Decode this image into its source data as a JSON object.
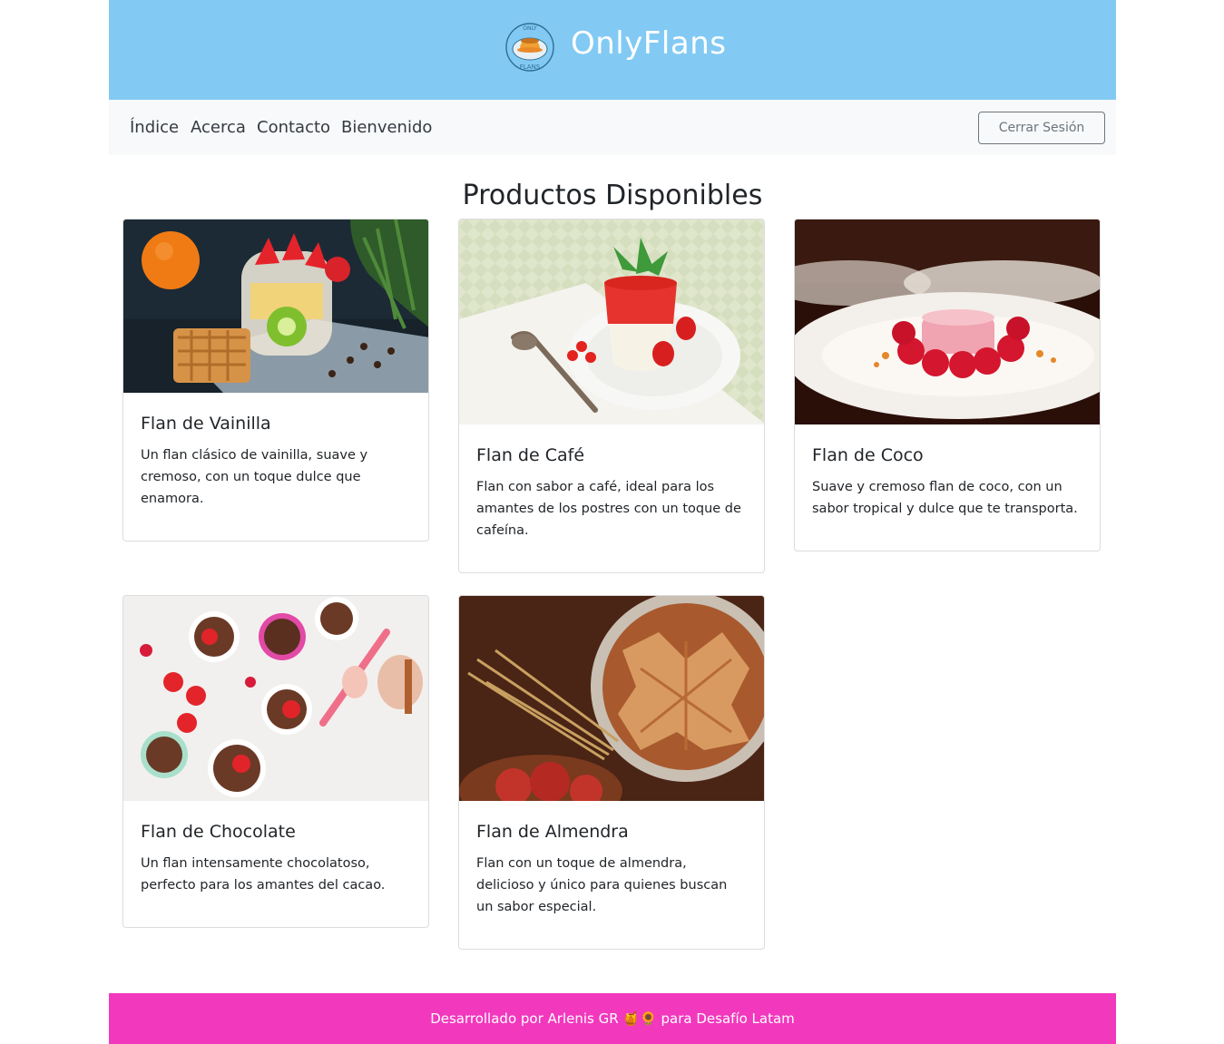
{
  "header": {
    "logo_text_top": "ONLY",
    "logo_text_bottom": "FLANS",
    "title": "OnlyFlans",
    "colors": {
      "bar": "#82caf4"
    }
  },
  "nav": {
    "links": [
      "Índice",
      "Acerca",
      "Contacto",
      "Bienvenido"
    ],
    "logout_label": "Cerrar Sesión"
  },
  "main": {
    "title": "Productos Disponibles",
    "products": [
      {
        "name": "Flan de Vainilla",
        "description": "Un flan clásico de vainilla, suave y cremoso, con un toque dulce que enamora.",
        "image": "fruit-parfait-with-waffle-photo"
      },
      {
        "name": "Flan de Café",
        "description": "Flan con sabor a café, ideal para los amantes de los postres con un toque de cafeína.",
        "image": "strawberry-panna-cotta-photo"
      },
      {
        "name": "Flan de Coco",
        "description": "Suave y cremoso flan de coco, con un sabor tropical y dulce que te transporta.",
        "image": "raspberry-dessert-plate-photo"
      },
      {
        "name": "Flan de Chocolate",
        "description": "Un flan intensamente chocolatoso, perfecto para los amantes del cacao.",
        "image": "chocolate-cups-strawberries-photo"
      },
      {
        "name": "Flan de Almendra",
        "description": "Flan con un toque de almendra, delicioso y único para quienes buscan un sabor especial.",
        "image": "pie-and-wheat-photo"
      }
    ]
  },
  "footer": {
    "text": "Desarrollado por Arlenis GR 🍯🌻 para Desafío Latam",
    "color": "#f238bd"
  }
}
